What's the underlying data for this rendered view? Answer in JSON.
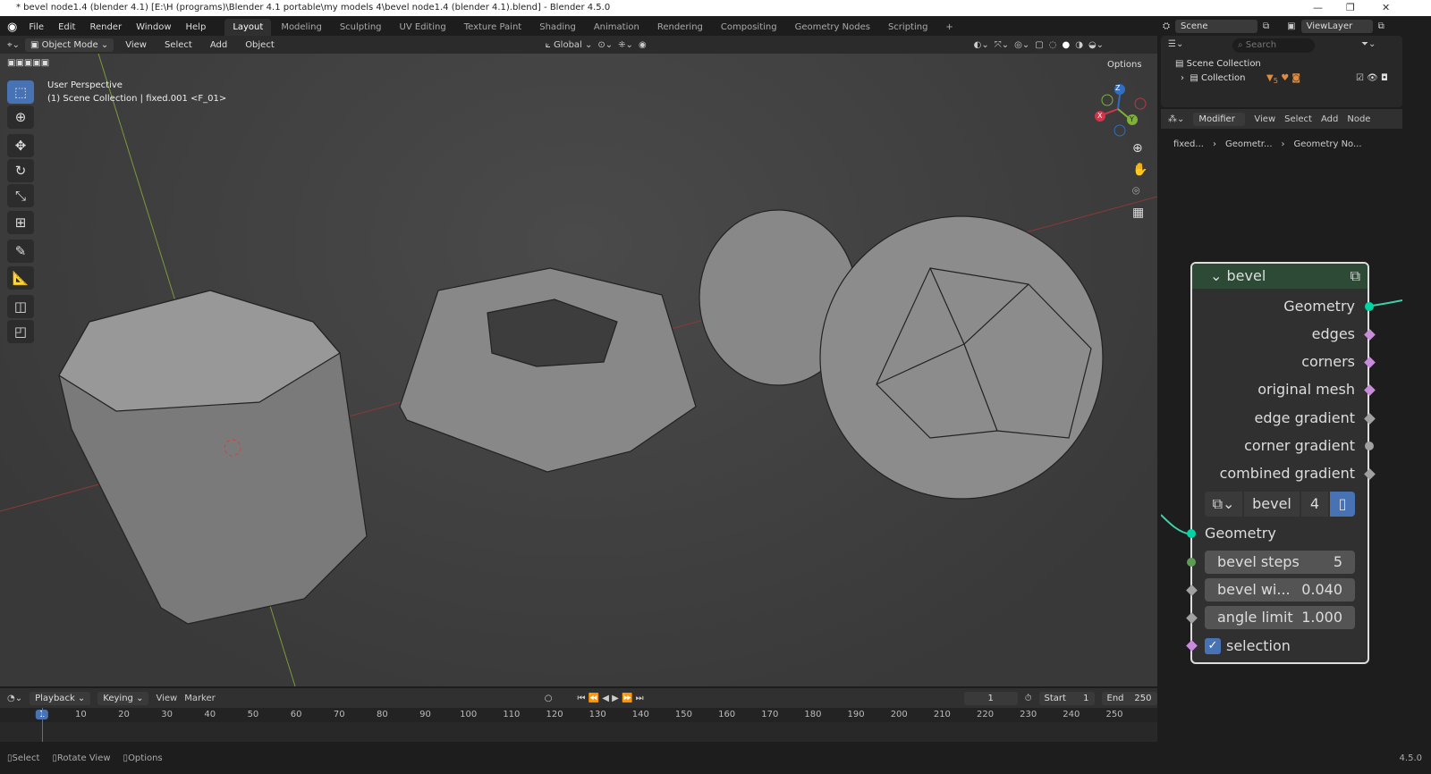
{
  "window": {
    "title": "* bevel node1.4 (blender 4.1) [E:\\H (programs)\\Blender 4.1 portable\\my models 4\\bevel node1.4 (blender 4.1).blend] - Blender 4.5.0"
  },
  "menu": [
    "File",
    "Edit",
    "Render",
    "Window",
    "Help"
  ],
  "workspaces": [
    "Layout",
    "Modeling",
    "Sculpting",
    "UV Editing",
    "Texture Paint",
    "Shading",
    "Animation",
    "Rendering",
    "Compositing",
    "Geometry Nodes",
    "Scripting"
  ],
  "active_workspace": "Layout",
  "viewport_header": {
    "mode": "Object Mode",
    "items": [
      "View",
      "Select",
      "Add",
      "Object"
    ],
    "orientation": "Global",
    "options": "Options"
  },
  "viewport": {
    "perspective": "User Perspective",
    "context": "(1) Scene Collection | fixed.001 <F_01>",
    "gizmo": {
      "x": "X",
      "y": "Y",
      "z": "Z"
    }
  },
  "scene": {
    "scene_name": "Scene",
    "view_layer": "ViewLayer",
    "search_placeholder": "Search"
  },
  "outliner": {
    "root": "Scene Collection",
    "child": "Collection",
    "count": "5"
  },
  "node_editor": {
    "type": "Modifier",
    "items": [
      "View",
      "Select",
      "Add",
      "Node"
    ],
    "breadcrumb": [
      "fixed...",
      "Geometr...",
      "Geometry No..."
    ]
  },
  "node": {
    "title": "bevel",
    "outputs": [
      "Geometry",
      "edges",
      "corners",
      "original mesh",
      "edge gradient",
      "corner gradient",
      "combined gradient"
    ],
    "group_name": "bevel",
    "group_users": "4",
    "input_geometry": "Geometry",
    "fields": [
      {
        "label": "bevel steps",
        "value": "5"
      },
      {
        "label": "bevel wi...",
        "value": "0.040"
      },
      {
        "label": "angle limit",
        "value": "1.000"
      }
    ],
    "selection_label": "selection",
    "selection_checked": true
  },
  "timeline": {
    "items": [
      "Playback",
      "Keying",
      "View",
      "Marker"
    ],
    "current_frame": "1",
    "start_label": "Start",
    "start": "1",
    "end_label": "End",
    "end": "250",
    "ticks": [
      "1",
      "10",
      "20",
      "30",
      "40",
      "50",
      "60",
      "70",
      "80",
      "90",
      "100",
      "110",
      "120",
      "130",
      "140",
      "150",
      "160",
      "170",
      "180",
      "190",
      "200",
      "210",
      "220",
      "230",
      "240",
      "250"
    ]
  },
  "status": {
    "select": "Select",
    "rotate": "Rotate View",
    "options": "Options",
    "version": "4.5.0"
  }
}
